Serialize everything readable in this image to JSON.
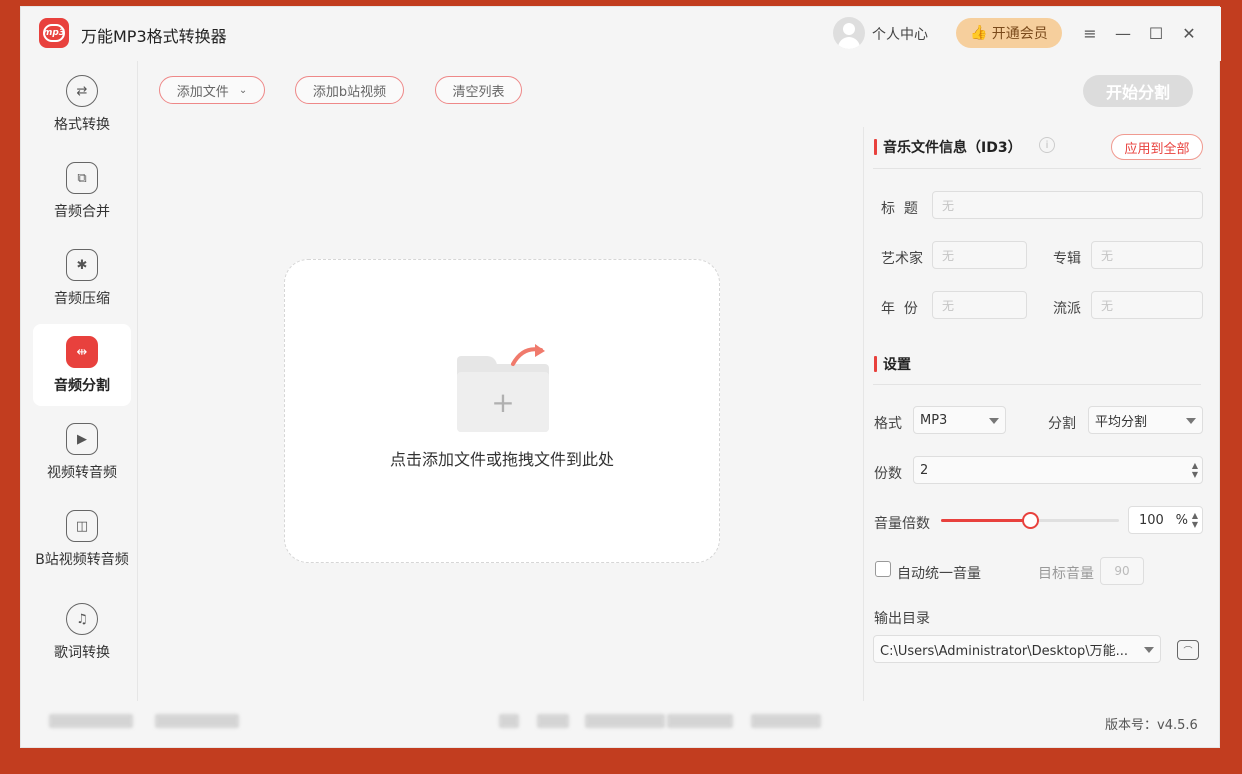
{
  "app": {
    "title": "万能MP3格式转换器",
    "logo_text": "mp3"
  },
  "header": {
    "user_center": "个人中心",
    "vip_label": "开通会员",
    "menu_icon": "≡",
    "minimize_icon": "—",
    "maximize_icon": "☐",
    "close_icon": "✕"
  },
  "sidebar": {
    "items": [
      {
        "label": "格式转换",
        "icon": "format-convert-icon"
      },
      {
        "label": "音频合并",
        "icon": "audio-merge-icon"
      },
      {
        "label": "音频压缩",
        "icon": "audio-compress-icon"
      },
      {
        "label": "音频分割",
        "icon": "audio-split-icon",
        "active": true
      },
      {
        "label": "视频转音频",
        "icon": "video-to-audio-icon"
      },
      {
        "label": "B站视频转音频",
        "icon": "bilibili-tv-icon"
      },
      {
        "label": "歌词转换",
        "icon": "lyrics-convert-icon"
      }
    ]
  },
  "toolbar": {
    "add_file": "添加文件",
    "add_bilibili": "添加b站视频",
    "clear_list": "清空列表",
    "start": "开始分割"
  },
  "dropzone": {
    "text": "点击添加文件或拖拽文件到此处",
    "plus": "+"
  },
  "id3": {
    "title": "音乐文件信息（ID3）",
    "apply_all": "应用到全部",
    "info_icon": "i",
    "fields": {
      "title_label": "标  题",
      "title_value": "无",
      "artist_label": "艺术家",
      "artist_value": "无",
      "album_label": "专辑",
      "album_value": "无",
      "year_label": "年  份",
      "year_value": "无",
      "genre_label": "流派",
      "genre_value": "无"
    }
  },
  "settings": {
    "title": "设置",
    "format_label": "格式",
    "format_value": "MP3",
    "split_label": "分割",
    "split_value": "平均分割",
    "parts_label": "份数",
    "parts_value": "2",
    "volume_label": "音量倍数",
    "volume_value": "100",
    "volume_unit": "%",
    "volume_fraction": 0.5,
    "auto_volume_label": "自动统一音量",
    "auto_volume_checked": false,
    "target_volume_label": "目标音量",
    "target_volume_value": "90",
    "output_label": "输出目录",
    "output_path": "C:\\Users\\Administrator\\Desktop\\万能..."
  },
  "footer": {
    "version": "版本号：v4.5.6"
  },
  "colors": {
    "accent": "#e8413d",
    "vip": "#f6cf9d",
    "background": "#c23d1f"
  }
}
